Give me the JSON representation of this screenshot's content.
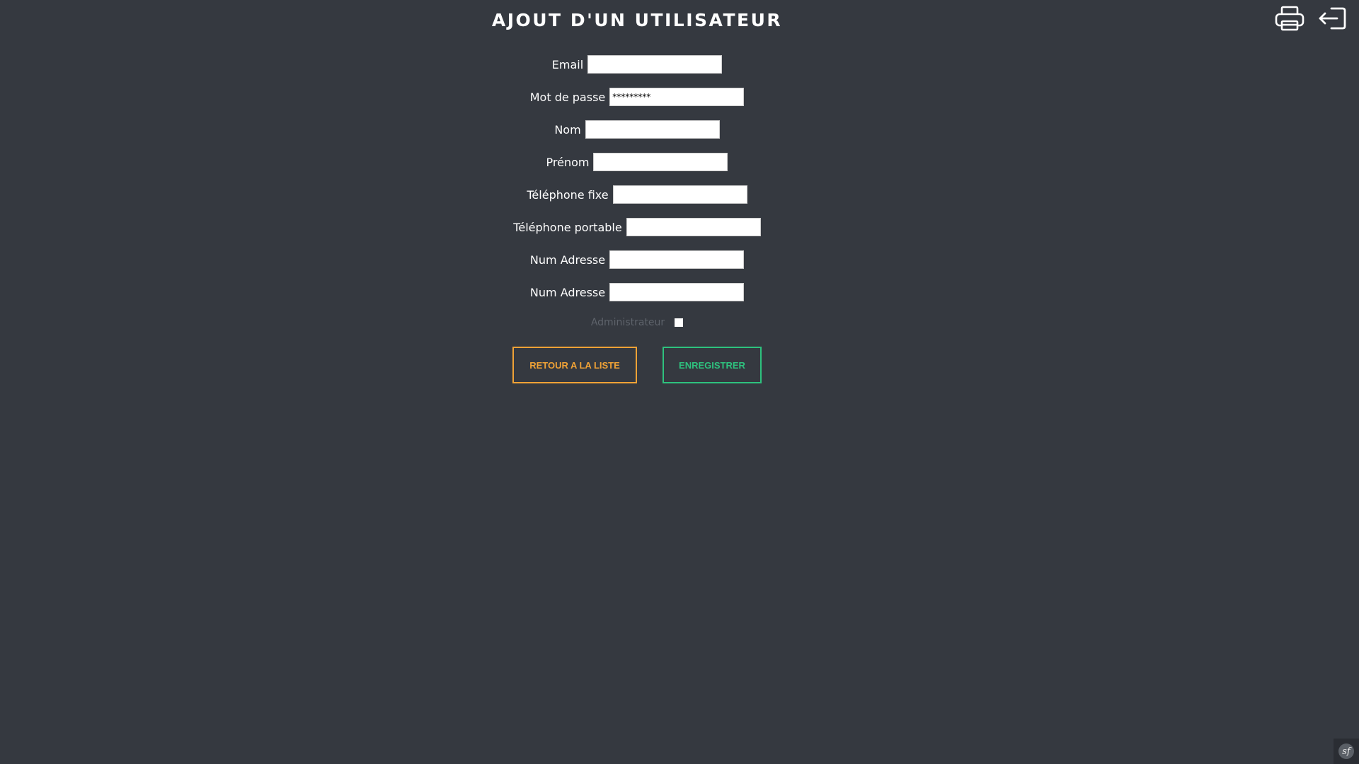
{
  "header": {
    "title": "AJOUT D'UN UTILISATEUR",
    "print_icon": "printer-icon",
    "logout_icon": "logout-icon"
  },
  "form": {
    "email_label": "Email",
    "email_value": "",
    "password_label": "Mot de passe",
    "password_value": "*********",
    "nom_label": "Nom",
    "nom_value": "",
    "prenom_label": "Prénom",
    "prenom_value": "",
    "tel_fixe_label": "Téléphone fixe",
    "tel_fixe_value": "",
    "tel_portable_label": "Téléphone portable",
    "tel_portable_value": "",
    "num_adresse_1_label": "Num Adresse",
    "num_adresse_1_value": "",
    "num_adresse_2_label": "Num Adresse",
    "num_adresse_2_value": "",
    "admin_label": "Administrateur",
    "admin_checked": false
  },
  "buttons": {
    "back_label": "RETOUR A LA LISTE",
    "save_label": "ENREGISTRER"
  },
  "colors": {
    "background": "#353940",
    "back_button": "#f0a236",
    "save_button": "#2ec27e",
    "disabled_label": "#5e636b"
  },
  "debug_toolbar": {
    "icon": "symfony-icon",
    "glyph": "sf"
  }
}
